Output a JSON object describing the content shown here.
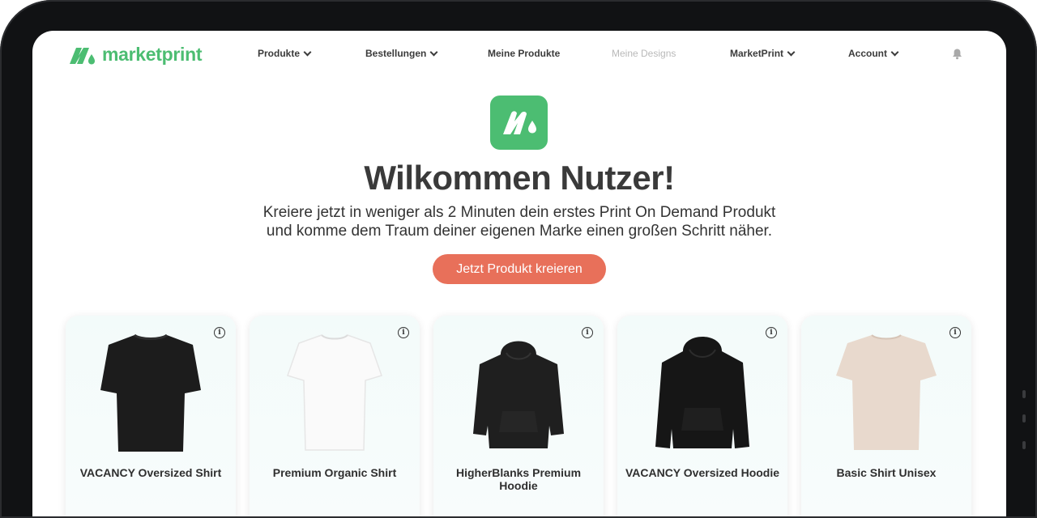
{
  "brand": {
    "name": "marketprint",
    "color": "#4cbd72"
  },
  "nav": {
    "items": [
      {
        "label": "Produkte"
      },
      {
        "label": "Bestellungen"
      },
      {
        "label": "Meine Produkte"
      },
      {
        "label": "Meine Designs"
      },
      {
        "label": "MarketPrint"
      },
      {
        "label": "Account"
      }
    ]
  },
  "hero": {
    "title": "Wilkommen Nutzer!",
    "subtitle_line1": "Kreiere jetzt in weniger als 2 Minuten dein erstes Print On Demand Produkt",
    "subtitle_line2": "und komme dem Traum deiner eigenen Marke einen großen Schritt näher.",
    "cta_label": "Jetzt Produkt kreieren",
    "cta_color": "#e8705a"
  },
  "products": [
    {
      "name": "VACANCY Oversized Shirt",
      "icon": "black-tshirt-icon",
      "color": "#1c1c1c"
    },
    {
      "name": "Premium Organic Shirt",
      "icon": "white-tshirt-icon",
      "color": "#fafafa"
    },
    {
      "name": "HigherBlanks Premium Hoodie",
      "icon": "black-hoodie-icon",
      "color": "#1f1f1f"
    },
    {
      "name": "VACANCY Oversized Hoodie",
      "icon": "black-hoodie-icon",
      "color": "#161616"
    },
    {
      "name": "Basic Shirt Unisex",
      "icon": "beige-tshirt-icon",
      "color": "#e8d9cd"
    }
  ]
}
